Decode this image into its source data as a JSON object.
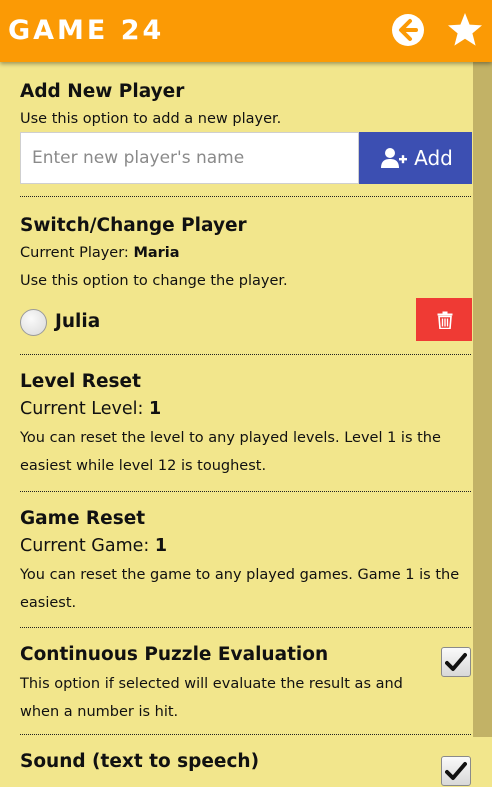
{
  "header": {
    "title": "GAME 24",
    "back_icon": "arrow-left-circle-icon",
    "star_icon": "star-icon"
  },
  "colors": {
    "header_bg": "#fb9a05",
    "content_bg": "#f2e68c",
    "add_button": "#3c4fb2",
    "delete_button": "#ef3a34"
  },
  "add_player": {
    "heading": "Add New Player",
    "description": "Use this option to add a new player.",
    "input_placeholder": "Enter new player's name",
    "input_value": "",
    "add_label": "Add"
  },
  "switch_player": {
    "heading": "Switch/Change Player",
    "current_label": "Current Player: ",
    "current_value": "Maria",
    "description": "Use this option to change the player.",
    "players": [
      {
        "name": "Julia",
        "selected": false
      }
    ]
  },
  "level_reset": {
    "heading": "Level Reset",
    "current_label": "Current Level: ",
    "current_value": "1",
    "description": "You can reset the level to any played levels. Level 1 is the easiest while level 12 is toughest."
  },
  "game_reset": {
    "heading": "Game Reset",
    "current_label": "Current Game: ",
    "current_value": "1",
    "description": "You can reset the game to any played games. Game 1 is the easiest."
  },
  "continuous_eval": {
    "heading": "Continuous Puzzle Evaluation",
    "description": "This option if selected will evaluate the result as and when a number is hit.",
    "checked": true
  },
  "sound": {
    "heading": "Sound (text to speech)",
    "checked": true
  }
}
